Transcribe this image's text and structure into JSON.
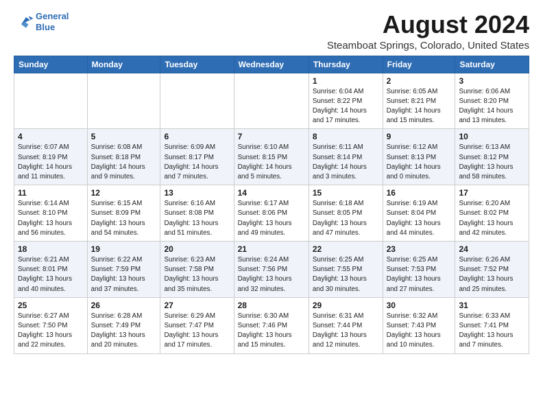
{
  "logo": {
    "line1": "General",
    "line2": "Blue"
  },
  "title": "August 2024",
  "subtitle": "Steamboat Springs, Colorado, United States",
  "days_of_week": [
    "Sunday",
    "Monday",
    "Tuesday",
    "Wednesday",
    "Thursday",
    "Friday",
    "Saturday"
  ],
  "weeks": [
    [
      {
        "day": "",
        "info": ""
      },
      {
        "day": "",
        "info": ""
      },
      {
        "day": "",
        "info": ""
      },
      {
        "day": "",
        "info": ""
      },
      {
        "day": "1",
        "info": "Sunrise: 6:04 AM\nSunset: 8:22 PM\nDaylight: 14 hours\nand 17 minutes."
      },
      {
        "day": "2",
        "info": "Sunrise: 6:05 AM\nSunset: 8:21 PM\nDaylight: 14 hours\nand 15 minutes."
      },
      {
        "day": "3",
        "info": "Sunrise: 6:06 AM\nSunset: 8:20 PM\nDaylight: 14 hours\nand 13 minutes."
      }
    ],
    [
      {
        "day": "4",
        "info": "Sunrise: 6:07 AM\nSunset: 8:19 PM\nDaylight: 14 hours\nand 11 minutes."
      },
      {
        "day": "5",
        "info": "Sunrise: 6:08 AM\nSunset: 8:18 PM\nDaylight: 14 hours\nand 9 minutes."
      },
      {
        "day": "6",
        "info": "Sunrise: 6:09 AM\nSunset: 8:17 PM\nDaylight: 14 hours\nand 7 minutes."
      },
      {
        "day": "7",
        "info": "Sunrise: 6:10 AM\nSunset: 8:15 PM\nDaylight: 14 hours\nand 5 minutes."
      },
      {
        "day": "8",
        "info": "Sunrise: 6:11 AM\nSunset: 8:14 PM\nDaylight: 14 hours\nand 3 minutes."
      },
      {
        "day": "9",
        "info": "Sunrise: 6:12 AM\nSunset: 8:13 PM\nDaylight: 14 hours\nand 0 minutes."
      },
      {
        "day": "10",
        "info": "Sunrise: 6:13 AM\nSunset: 8:12 PM\nDaylight: 13 hours\nand 58 minutes."
      }
    ],
    [
      {
        "day": "11",
        "info": "Sunrise: 6:14 AM\nSunset: 8:10 PM\nDaylight: 13 hours\nand 56 minutes."
      },
      {
        "day": "12",
        "info": "Sunrise: 6:15 AM\nSunset: 8:09 PM\nDaylight: 13 hours\nand 54 minutes."
      },
      {
        "day": "13",
        "info": "Sunrise: 6:16 AM\nSunset: 8:08 PM\nDaylight: 13 hours\nand 51 minutes."
      },
      {
        "day": "14",
        "info": "Sunrise: 6:17 AM\nSunset: 8:06 PM\nDaylight: 13 hours\nand 49 minutes."
      },
      {
        "day": "15",
        "info": "Sunrise: 6:18 AM\nSunset: 8:05 PM\nDaylight: 13 hours\nand 47 minutes."
      },
      {
        "day": "16",
        "info": "Sunrise: 6:19 AM\nSunset: 8:04 PM\nDaylight: 13 hours\nand 44 minutes."
      },
      {
        "day": "17",
        "info": "Sunrise: 6:20 AM\nSunset: 8:02 PM\nDaylight: 13 hours\nand 42 minutes."
      }
    ],
    [
      {
        "day": "18",
        "info": "Sunrise: 6:21 AM\nSunset: 8:01 PM\nDaylight: 13 hours\nand 40 minutes."
      },
      {
        "day": "19",
        "info": "Sunrise: 6:22 AM\nSunset: 7:59 PM\nDaylight: 13 hours\nand 37 minutes."
      },
      {
        "day": "20",
        "info": "Sunrise: 6:23 AM\nSunset: 7:58 PM\nDaylight: 13 hours\nand 35 minutes."
      },
      {
        "day": "21",
        "info": "Sunrise: 6:24 AM\nSunset: 7:56 PM\nDaylight: 13 hours\nand 32 minutes."
      },
      {
        "day": "22",
        "info": "Sunrise: 6:25 AM\nSunset: 7:55 PM\nDaylight: 13 hours\nand 30 minutes."
      },
      {
        "day": "23",
        "info": "Sunrise: 6:25 AM\nSunset: 7:53 PM\nDaylight: 13 hours\nand 27 minutes."
      },
      {
        "day": "24",
        "info": "Sunrise: 6:26 AM\nSunset: 7:52 PM\nDaylight: 13 hours\nand 25 minutes."
      }
    ],
    [
      {
        "day": "25",
        "info": "Sunrise: 6:27 AM\nSunset: 7:50 PM\nDaylight: 13 hours\nand 22 minutes."
      },
      {
        "day": "26",
        "info": "Sunrise: 6:28 AM\nSunset: 7:49 PM\nDaylight: 13 hours\nand 20 minutes."
      },
      {
        "day": "27",
        "info": "Sunrise: 6:29 AM\nSunset: 7:47 PM\nDaylight: 13 hours\nand 17 minutes."
      },
      {
        "day": "28",
        "info": "Sunrise: 6:30 AM\nSunset: 7:46 PM\nDaylight: 13 hours\nand 15 minutes."
      },
      {
        "day": "29",
        "info": "Sunrise: 6:31 AM\nSunset: 7:44 PM\nDaylight: 13 hours\nand 12 minutes."
      },
      {
        "day": "30",
        "info": "Sunrise: 6:32 AM\nSunset: 7:43 PM\nDaylight: 13 hours\nand 10 minutes."
      },
      {
        "day": "31",
        "info": "Sunrise: 6:33 AM\nSunset: 7:41 PM\nDaylight: 13 hours\nand 7 minutes."
      }
    ]
  ]
}
